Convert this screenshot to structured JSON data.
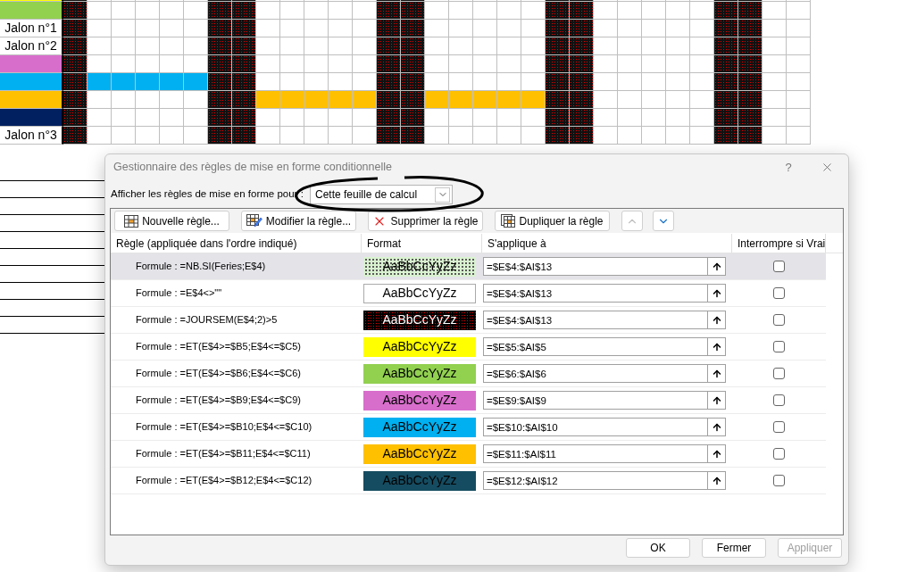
{
  "sheet": {
    "columns": [
      {
        "weekend": true
      },
      {
        "weekend": false
      },
      {
        "weekend": false
      },
      {
        "weekend": false
      },
      {
        "weekend": false
      },
      {
        "weekend": false
      },
      {
        "weekend": true
      },
      {
        "weekend": true
      },
      {
        "weekend": false
      },
      {
        "weekend": false
      },
      {
        "weekend": false
      },
      {
        "weekend": false
      },
      {
        "weekend": false
      },
      {
        "weekend": true
      },
      {
        "weekend": true
      },
      {
        "weekend": false
      },
      {
        "weekend": false
      },
      {
        "weekend": false
      },
      {
        "weekend": false
      },
      {
        "weekend": false
      },
      {
        "weekend": true
      },
      {
        "weekend": true
      },
      {
        "weekend": false
      },
      {
        "weekend": false
      },
      {
        "weekend": false
      },
      {
        "weekend": false
      },
      {
        "weekend": false
      },
      {
        "weekend": true
      },
      {
        "weekend": true
      },
      {
        "weekend": false
      },
      {
        "weekend": false
      }
    ],
    "rows": [
      {
        "color": "#ffff00"
      },
      {
        "color": "#92d050"
      },
      {
        "label": "Jalon n°1"
      },
      {
        "label": "Jalon n°2"
      },
      {
        "color": "#d86ecc"
      },
      {
        "color": "#00b0f0",
        "cells": [
          {
            "filled": false
          },
          {
            "filled": true
          },
          {
            "filled": true
          },
          {
            "filled": true
          },
          {
            "filled": true
          },
          {
            "filled": true
          },
          {
            "filled": false
          },
          {
            "filled": false
          },
          {
            "filled": false
          },
          {
            "filled": false
          },
          {
            "filled": false
          },
          {
            "filled": false
          },
          {
            "filled": false
          },
          {
            "filled": false
          },
          {
            "filled": false
          },
          {
            "filled": false
          },
          {
            "filled": false
          },
          {
            "filled": false
          },
          {
            "filled": false
          },
          {
            "filled": false
          },
          {
            "filled": false
          },
          {
            "filled": false
          },
          {
            "filled": false
          },
          {
            "filled": false
          },
          {
            "filled": false
          },
          {
            "filled": false
          },
          {
            "filled": false
          },
          {
            "filled": false
          },
          {
            "filled": false
          },
          {
            "filled": false
          },
          {
            "filled": false
          }
        ]
      },
      {
        "color": "#ffc000",
        "cells": [
          {
            "filled": false
          },
          {
            "filled": false
          },
          {
            "filled": false
          },
          {
            "filled": false
          },
          {
            "filled": false
          },
          {
            "filled": false
          },
          {
            "filled": false
          },
          {
            "filled": false
          },
          {
            "filled": true
          },
          {
            "filled": true
          },
          {
            "filled": true
          },
          {
            "filled": true
          },
          {
            "filled": true
          },
          {
            "filled": false
          },
          {
            "filled": false
          },
          {
            "filled": true
          },
          {
            "filled": true
          },
          {
            "filled": true
          },
          {
            "filled": true
          },
          {
            "filled": true
          },
          {
            "filled": false
          },
          {
            "filled": false
          },
          {
            "filled": false
          },
          {
            "filled": false
          },
          {
            "filled": false
          },
          {
            "filled": false
          },
          {
            "filled": false
          },
          {
            "filled": false
          },
          {
            "filled": false
          },
          {
            "filled": false
          },
          {
            "filled": false
          }
        ]
      },
      {
        "color": "#002060"
      },
      {
        "label": "Jalon n°3"
      }
    ]
  },
  "dialog": {
    "title": "Gestionnaire des règles de mise en forme conditionnelle",
    "help": "?",
    "show_for": {
      "label": "Afficher les règles de mise en forme pour :",
      "value": "Cette feuille de calcul"
    },
    "toolbar": [
      {
        "label": "Nouvelle règle...",
        "kind": "new"
      },
      {
        "label": "Modifier la règle...",
        "kind": "edit"
      },
      {
        "label": "Supprimer la règle",
        "kind": "delete"
      },
      {
        "label": "Dupliquer la règle",
        "kind": "duplicate"
      }
    ],
    "move_up": {
      "disabled": true
    },
    "move_down": {
      "disabled": false
    },
    "columns": [
      "Règle (appliquée dans l'ordre indiqué)",
      "Format",
      "S'applique à",
      "Interrompre si Vrai"
    ],
    "rules": [
      {
        "rule": "Formule : =NB.SI(Feries;E$4)",
        "format": {
          "kind": "dotted_light",
          "color": "#d9f2d0"
        },
        "preview": "AaBbCcYyZz",
        "applies_to": "=$E$4:$AI$13",
        "stop_if_true": false,
        "selected": true
      },
      {
        "rule": "Formule : =E$4<>\"\"",
        "format": {
          "kind": "none"
        },
        "preview": "AaBbCcYyZz",
        "applies_to": "=$E$4:$AI$13",
        "stop_if_true": false,
        "selected": false
      },
      {
        "rule": "Formule : =JOURSEM(E$4;2)>5",
        "format": {
          "kind": "dotted_dark",
          "color": "#000000"
        },
        "preview": "AaBbCcYyZz",
        "applies_to": "=$E$4:$AI$13",
        "stop_if_true": false,
        "selected": false
      },
      {
        "rule": "Formule : =ET(E$4>=$B5;E$4<=$C5)",
        "format": {
          "kind": "fill",
          "color": "#ffff00"
        },
        "preview": "AaBbCcYyZz",
        "applies_to": "=$E$5:$AI$5",
        "stop_if_true": false,
        "selected": false
      },
      {
        "rule": "Formule : =ET(E$4>=$B6;E$4<=$C6)",
        "format": {
          "kind": "fill",
          "color": "#92d050"
        },
        "preview": "AaBbCcYyZz",
        "applies_to": "=$E$6:$AI$6",
        "stop_if_true": false,
        "selected": false
      },
      {
        "rule": "Formule : =ET(E$4>=$B9;E$4<=$C9)",
        "format": {
          "kind": "fill",
          "color": "#d86ecc"
        },
        "preview": "AaBbCcYyZz",
        "applies_to": "=$E$9:$AI$9",
        "stop_if_true": false,
        "selected": false
      },
      {
        "rule": "Formule : =ET(E$4>=$B10;E$4<=$C10)",
        "format": {
          "kind": "fill",
          "color": "#00b0f0"
        },
        "preview": "AaBbCcYyZz",
        "applies_to": "=$E$10:$AI$10",
        "stop_if_true": false,
        "selected": false
      },
      {
        "rule": "Formule : =ET(E$4>=$B11;E$4<=$C11)",
        "format": {
          "kind": "fill",
          "color": "#ffc000"
        },
        "preview": "AaBbCcYyZz",
        "applies_to": "=$E$11:$AI$11",
        "stop_if_true": false,
        "selected": false
      },
      {
        "rule": "Formule : =ET(E$4>=$B12;E$4<=$C12)",
        "format": {
          "kind": "fill",
          "color": "#154c61"
        },
        "preview": "AaBbCcYyZz",
        "applies_to": "=$E$12:$AI$12",
        "stop_if_true": false,
        "selected": false
      }
    ],
    "buttons": [
      {
        "label": "OK",
        "disabled": false
      },
      {
        "label": "Fermer",
        "disabled": false
      },
      {
        "label": "Appliquer",
        "disabled": true
      }
    ]
  }
}
